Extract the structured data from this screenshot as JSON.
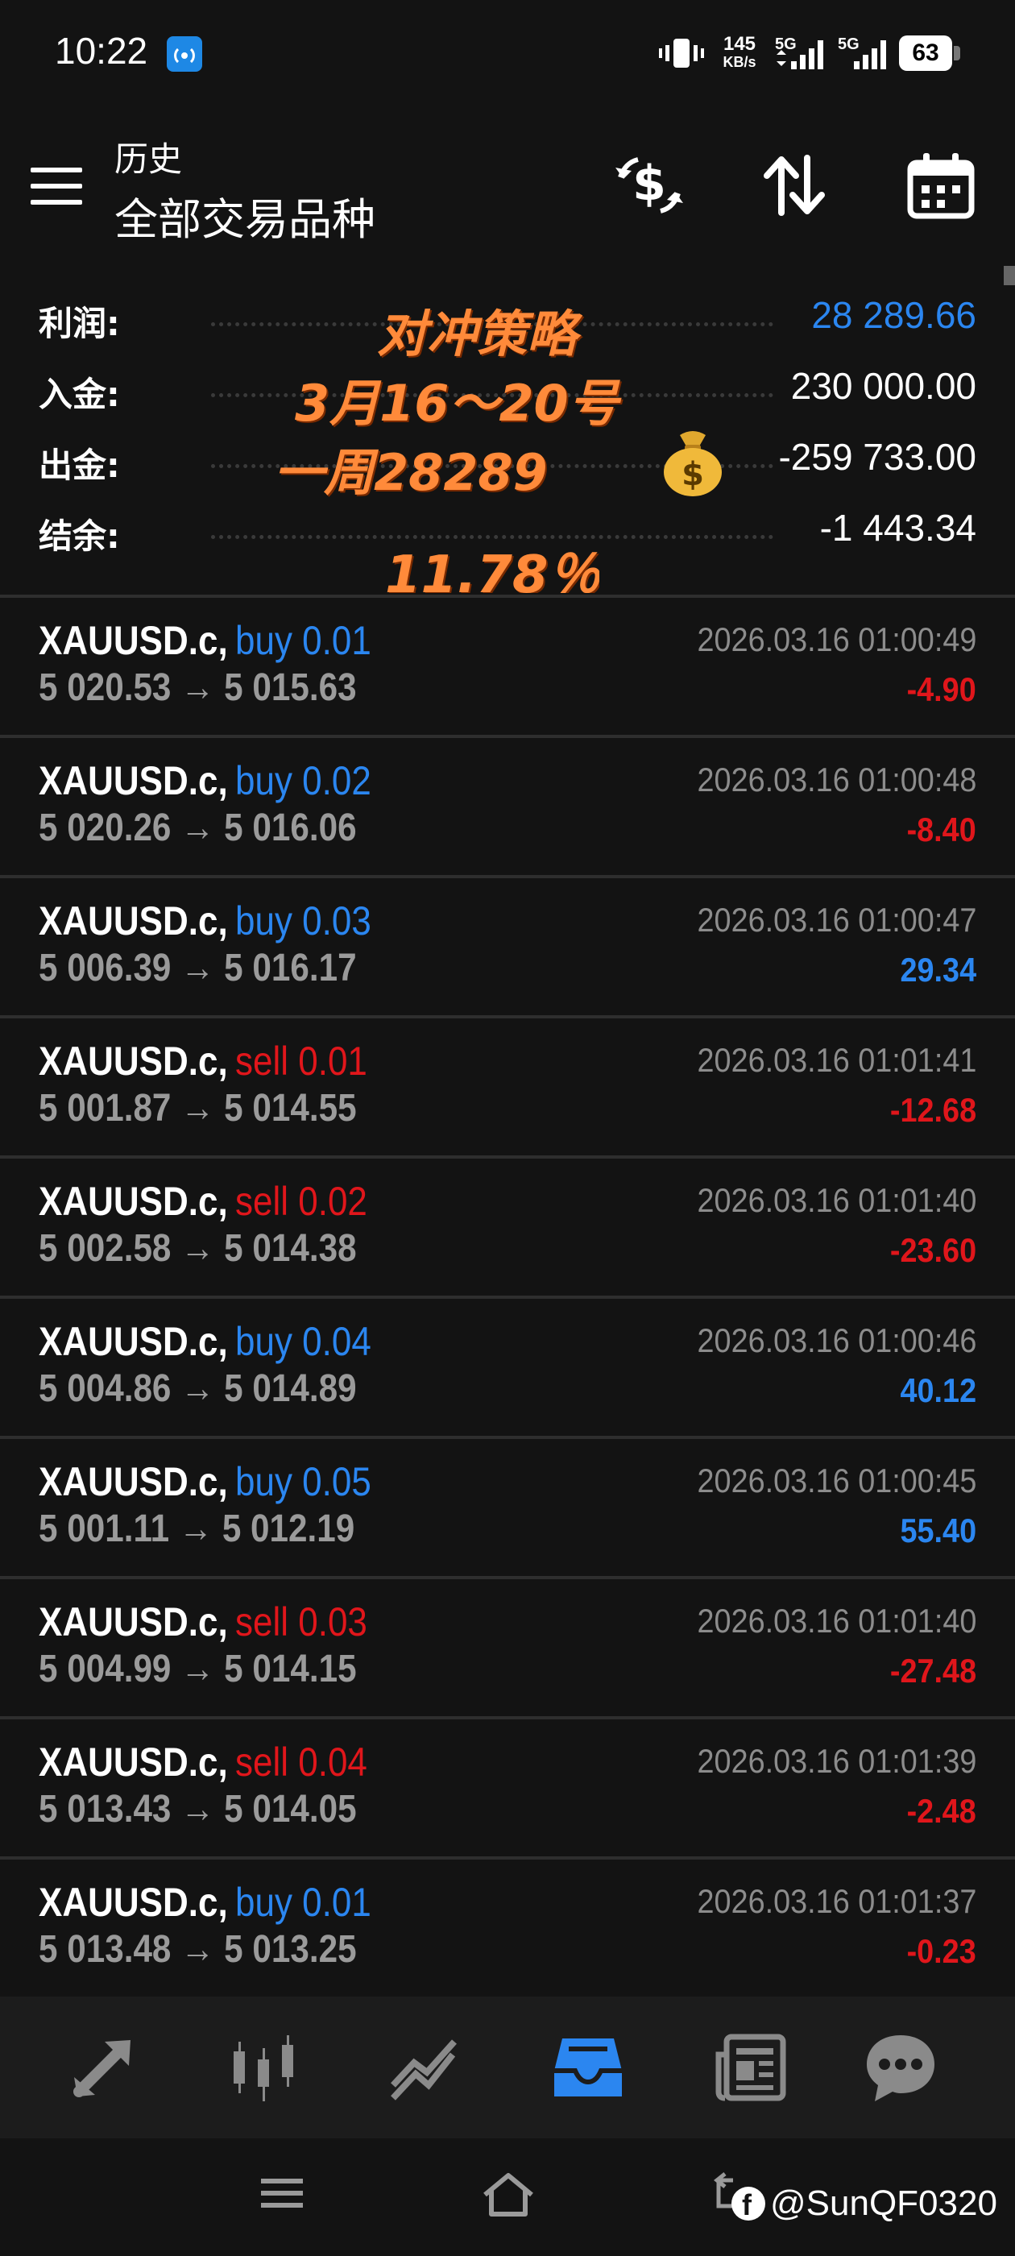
{
  "status_bar": {
    "time": "10:22",
    "net_speed_value": "145",
    "net_speed_unit": "KB/s",
    "network_1": "5G",
    "network_2": "5G",
    "battery": "63"
  },
  "header": {
    "subtitle": "历史",
    "title": "全部交易品种",
    "icons": [
      "dollar-exchange-icon",
      "sort-icon",
      "calendar-icon"
    ]
  },
  "summary": {
    "rows": [
      {
        "label": "利润:",
        "value": "28 289.66",
        "color": "#2b86f0"
      },
      {
        "label": "入金:",
        "value": "230 000.00"
      },
      {
        "label": "出金:",
        "value": "-259 733.00"
      },
      {
        "label": "结余:",
        "value": "-1 443.34"
      }
    ],
    "overlay": {
      "line1": "对冲策略",
      "line2": "3月16～20号",
      "line3": "一周28289",
      "line4": "11.78％",
      "emoji": "money-bag-icon",
      "color": "#ff8a3a"
    }
  },
  "trades": [
    {
      "symbol": "XAUUSD.c,",
      "side": "buy 0.01",
      "type": "buy",
      "open": "5 020.53",
      "close": "5 015.63",
      "time": "2026.03.16 01:00:49",
      "profit": "-4.90"
    },
    {
      "symbol": "XAUUSD.c,",
      "side": "buy 0.02",
      "type": "buy",
      "open": "5 020.26",
      "close": "5 016.06",
      "time": "2026.03.16 01:00:48",
      "profit": "-8.40"
    },
    {
      "symbol": "XAUUSD.c,",
      "side": "buy 0.03",
      "type": "buy",
      "open": "5 006.39",
      "close": "5 016.17",
      "time": "2026.03.16 01:00:47",
      "profit": "29.34"
    },
    {
      "symbol": "XAUUSD.c,",
      "side": "sell 0.01",
      "type": "sell",
      "open": "5 001.87",
      "close": "5 014.55",
      "time": "2026.03.16 01:01:41",
      "profit": "-12.68"
    },
    {
      "symbol": "XAUUSD.c,",
      "side": "sell 0.02",
      "type": "sell",
      "open": "5 002.58",
      "close": "5 014.38",
      "time": "2026.03.16 01:01:40",
      "profit": "-23.60"
    },
    {
      "symbol": "XAUUSD.c,",
      "side": "buy 0.04",
      "type": "buy",
      "open": "5 004.86",
      "close": "5 014.89",
      "time": "2026.03.16 01:00:46",
      "profit": "40.12"
    },
    {
      "symbol": "XAUUSD.c,",
      "side": "buy 0.05",
      "type": "buy",
      "open": "5 001.11",
      "close": "5 012.19",
      "time": "2026.03.16 01:00:45",
      "profit": "55.40"
    },
    {
      "symbol": "XAUUSD.c,",
      "side": "sell 0.03",
      "type": "sell",
      "open": "5 004.99",
      "close": "5 014.15",
      "time": "2026.03.16 01:01:40",
      "profit": "-27.48"
    },
    {
      "symbol": "XAUUSD.c,",
      "side": "sell 0.04",
      "type": "sell",
      "open": "5 013.43",
      "close": "5 014.05",
      "time": "2026.03.16 01:01:39",
      "profit": "-2.48"
    },
    {
      "symbol": "XAUUSD.c,",
      "side": "buy 0.01",
      "type": "buy",
      "open": "5 013.48",
      "close": "5 013.25",
      "time": "2026.03.16 01:01:37",
      "profit": "-0.23"
    }
  ],
  "arrow": "→",
  "bottom_nav": {
    "items": [
      "trade-arrows-icon",
      "candlestick-chart-icon",
      "trend-chart-icon",
      "history-inbox-icon",
      "news-icon",
      "chat-icon"
    ],
    "active": "history-inbox-icon",
    "active_color": "#2b86f0"
  },
  "watermark": {
    "badge": "f",
    "text": "@SunQF0320"
  }
}
